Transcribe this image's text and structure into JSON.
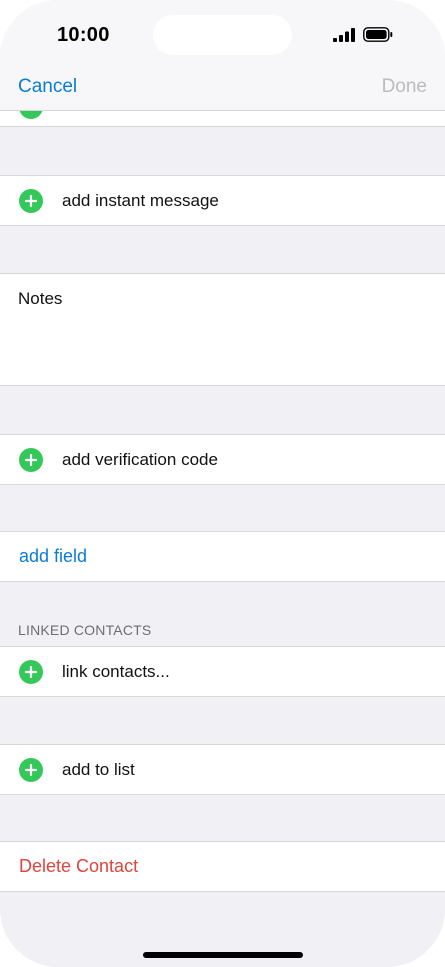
{
  "status_bar": {
    "time": "10:00",
    "signal_icon": "signal-bars-icon",
    "battery_icon": "battery-icon"
  },
  "nav": {
    "cancel_label": "Cancel",
    "done_label": "Done"
  },
  "rows": {
    "instant_message": "add instant message",
    "notes": "Notes",
    "verification_code": "add verification code",
    "add_field": "add field",
    "linked_contacts_header": "LINKED CONTACTS",
    "link_contacts": "link contacts...",
    "add_to_list": "add to list",
    "delete_contact": "Delete Contact"
  },
  "icons": {
    "add": "plus-circle-icon"
  },
  "colors": {
    "accent_blue": "#0a7cd6",
    "add_green": "#34c759",
    "destructive_red": "#e0443c",
    "disabled_gray": "#bcbcc0",
    "grouped_background": "#f0f0f5"
  }
}
